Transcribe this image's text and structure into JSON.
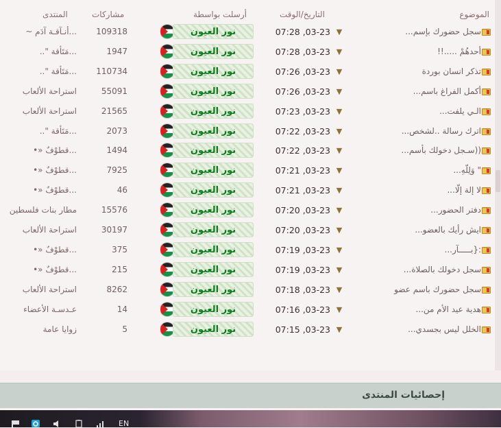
{
  "headers": {
    "topic": "الموضوع",
    "datetime": "التاريخ/الوقت",
    "sent_by": "أرسلت بواسطة",
    "posts": "مشاركات",
    "forum": "المنتدى"
  },
  "rows": [
    {
      "topic": "سجل حضورك بإسم...",
      "date": "07:28 ,03-23",
      "user": "نور العيون",
      "posts": "109318",
      "forum": "~ أنـآقـة آدَم..."
    },
    {
      "topic": "أحدهُمْ .....!!",
      "date": "07:28 ,03-23",
      "user": "نور العيون",
      "posts": "1947",
      "forum": "..\" مَتَأقة..."
    },
    {
      "topic": "تذكر انسان بوردة",
      "date": "07:26 ,03-23",
      "user": "نور العيون",
      "posts": "110734",
      "forum": "..\" مَتَأقة..."
    },
    {
      "topic": "أكمل الفراغ باسم...",
      "date": "07:26 ,03-23",
      "user": "نور العيون",
      "posts": "55091",
      "forum": "استراحة الألعاب"
    },
    {
      "topic": "الـي يلفت...",
      "date": "07:23 ,03-23",
      "user": "نور العيون",
      "posts": "21565",
      "forum": "استراحة الألعاب"
    },
    {
      "topic": "اترك رسالة ..لشخص...",
      "date": "07:22 ,03-23",
      "user": "نور العيون",
      "posts": "2073",
      "forum": "..\" مَتَأقة..."
    },
    {
      "topic": "((سـجل دخولك بأسم...",
      "date": "07:22 ,03-23",
      "user": "نور العيون",
      "posts": "1494",
      "forum": "•» قطوْفٌ..."
    },
    {
      "topic": "\" وَلِلّهِ...",
      "date": "07:21 ,03-23",
      "user": "نور العيون",
      "posts": "7925",
      "forum": "•» قطوْفٌ..."
    },
    {
      "topic": "لا إلة إلّا...",
      "date": "07:21 ,03-23",
      "user": "نور العيون",
      "posts": "46",
      "forum": "•» قطوْفٌ..."
    },
    {
      "topic": "دفتر الحضور...",
      "date": "07:20 ,03-23",
      "user": "نور العيون",
      "posts": "15576",
      "forum": "مطار بنات فلسطين"
    },
    {
      "topic": "ايش رأيك بالعضو...",
      "date": "07:20 ,03-23",
      "user": "نور العيون",
      "posts": "30197",
      "forum": "استراحة الألعاب"
    },
    {
      "topic": ":{بـــــآر...",
      "date": "07:19 ,03-23",
      "user": "نور العيون",
      "posts": "375",
      "forum": "•» قطوْفٌ..."
    },
    {
      "topic": "سجل دخولك بالصلاة...",
      "date": "07:19 ,03-23",
      "user": "نور العيون",
      "posts": "215",
      "forum": "•» قطوْفٌ..."
    },
    {
      "topic": "سجل حضورك باسم عضو",
      "date": "07:18 ,03-23",
      "user": "نور العيون",
      "posts": "8262",
      "forum": "استراحة الألعاب"
    },
    {
      "topic": "هدية عيد الأم من...",
      "date": "07:16 ,03-23",
      "user": "نور العيون",
      "posts": "14",
      "forum": "عـدسـة الأعضاء"
    },
    {
      "topic": "الخلل ليس بجسدي...",
      "date": "07:15 ,03-23",
      "user": "نور العيون",
      "posts": "5",
      "forum": "زوايا عامة"
    }
  ],
  "stats_title": "إحصائيات المنتدى",
  "taskbar": {
    "lang": "EN"
  },
  "colors": {
    "username": "#0b7d1e",
    "stats_bar": "#c8d1cc",
    "folder": "#f2c44b"
  }
}
